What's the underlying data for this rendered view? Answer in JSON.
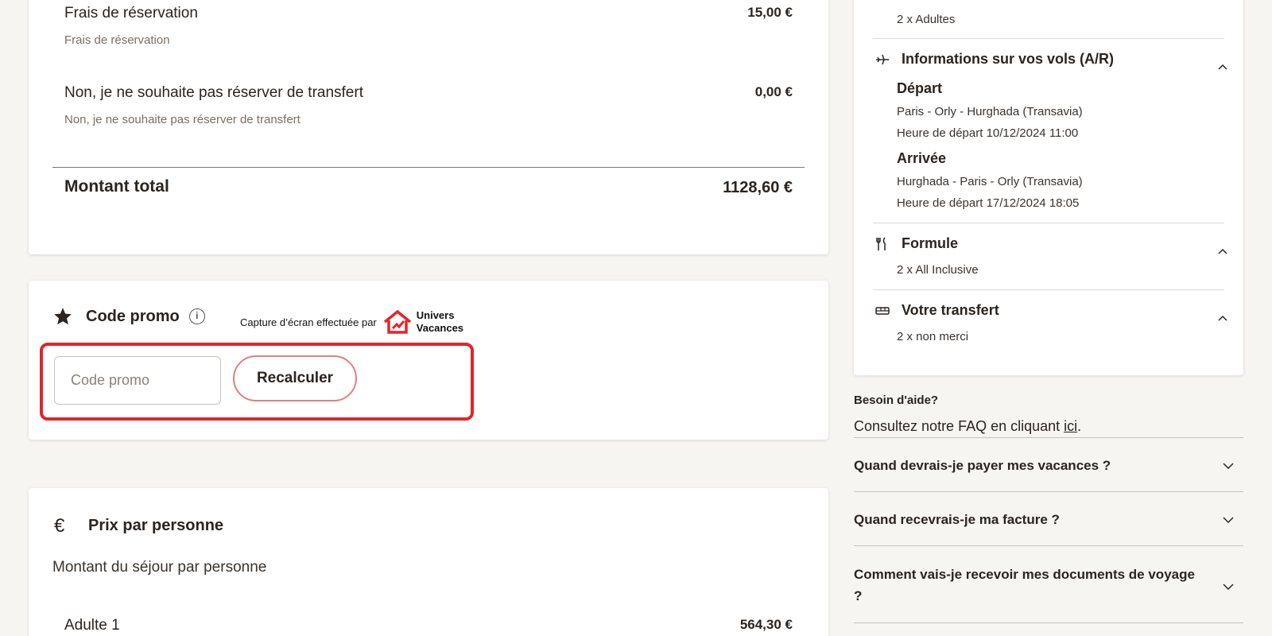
{
  "summary": {
    "items": [
      {
        "title": "Frais de réservation",
        "subtitle": "Frais de réservation",
        "price": "15,00 €"
      },
      {
        "title": "Non, je ne souhaite pas réserver de transfert",
        "subtitle": "Non, je ne souhaite pas réserver de transfert",
        "price": "0,00 €"
      }
    ],
    "total_label": "Montant total",
    "total_price": "1128,60 €"
  },
  "promo": {
    "title": "Code promo",
    "info_icon": "i",
    "input_placeholder": "Code promo",
    "button_label": "Recalculer",
    "highlight_color": "#e3242b"
  },
  "watermark": {
    "text": "Capture d’écran effectuée par",
    "brand_line1": "Univers",
    "brand_line2": "Vacances"
  },
  "price_per_person": {
    "currency_icon": "€",
    "title": "Prix par personne",
    "subtitle": "Montant du séjour par personne",
    "rows": [
      {
        "label": "Adulte 1",
        "price": "564,30 €"
      }
    ]
  },
  "info": {
    "travellers": "2 x Adultes",
    "flights": {
      "title": "Informations sur vos vols (A/R)",
      "departure_title": "Départ",
      "departure_route": "Paris - Orly - Hurghada (Transavia)",
      "departure_time": "Heure de départ 10/12/2024 11:00",
      "arrival_title": "Arrivée",
      "arrival_route": "Hurghada - Paris - Orly (Transavia)",
      "arrival_time": "Heure de départ 17/12/2024 18:05"
    },
    "formula": {
      "title": "Formule",
      "value": "2 x All Inclusive"
    },
    "transfer": {
      "title": "Votre transfert",
      "value": "2 x non merci"
    }
  },
  "help": {
    "title": "Besoin d'aide?",
    "text_before": "Consultez notre FAQ en cliquant ",
    "link": "ici",
    "text_after": ".",
    "faq": [
      "Quand devrais-je payer mes vacances ?",
      "Quand recevrais-je ma facture ?",
      "Comment vais-je recevoir mes documents de voyage ?"
    ]
  }
}
